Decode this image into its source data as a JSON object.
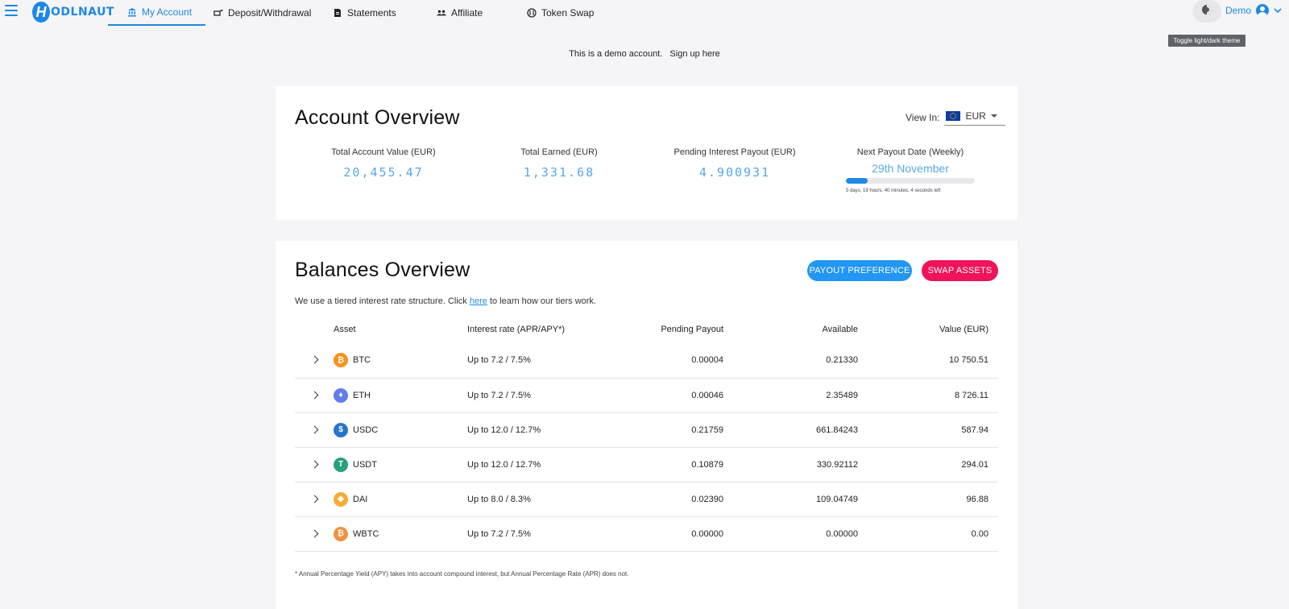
{
  "nav": {
    "logo_letter": "H",
    "logo_text": "ODLNAUT",
    "tabs": [
      {
        "label": "My Account",
        "icon": "bank-icon"
      },
      {
        "label": "Deposit/Withdrawal",
        "icon": "cash-transfer-icon"
      },
      {
        "label": "Statements",
        "icon": "document-icon"
      },
      {
        "label": "Affiliate",
        "icon": "people-icon"
      },
      {
        "label": "Token Swap",
        "icon": "swap-icon"
      }
    ],
    "theme_tooltip": "Toggle light/dark theme",
    "user_label": "Demo"
  },
  "demo": {
    "text": "This is a demo account.",
    "link": "Sign up here"
  },
  "account": {
    "title": "Account Overview",
    "view_in_label": "View In:",
    "currency": "EUR",
    "stats": [
      {
        "label": "Total Account Value (EUR)",
        "value": "20,455.47"
      },
      {
        "label": "Total Earned (EUR)",
        "value": "1,331.68"
      },
      {
        "label": "Pending Interest Payout (EUR)",
        "value": "4.900931"
      }
    ],
    "payout": {
      "label": "Next Payout Date (Weekly)",
      "date": "29th November",
      "progress_fraction": 0.17,
      "countdown": "5 days, 19 hours, 40 minutes, 4 seconds left"
    }
  },
  "balances": {
    "title": "Balances Overview",
    "payout_pref_button": "PAYOUT PREFERENCE",
    "swap_button": "SWAP ASSETS",
    "tier_note_before": "We use a tiered interest rate structure. Click ",
    "tier_note_link": "here",
    "tier_note_after": " to learn how our tiers work.",
    "columns": {
      "asset": "Asset",
      "rate": "Interest rate (APR/APY*)",
      "pending": "Pending Payout",
      "available": "Available",
      "value": "Value (EUR)"
    },
    "rows": [
      {
        "asset": "BTC",
        "rate": "Up to 7.2 / 7.5%",
        "pending": "0.00004",
        "available": "0.21330",
        "value": "10 750.51"
      },
      {
        "asset": "ETH",
        "rate": "Up to 7.2 / 7.5%",
        "pending": "0.00046",
        "available": "2.35489",
        "value": "8 726.11"
      },
      {
        "asset": "USDC",
        "rate": "Up to 12.0 / 12.7%",
        "pending": "0.21759",
        "available": "661.84243",
        "value": "587.94"
      },
      {
        "asset": "USDT",
        "rate": "Up to 12.0 / 12.7%",
        "pending": "0.10879",
        "available": "330.92112",
        "value": "294.01"
      },
      {
        "asset": "DAI",
        "rate": "Up to 8.0 / 8.3%",
        "pending": "0.02390",
        "available": "109.04749",
        "value": "96.88"
      },
      {
        "asset": "WBTC",
        "rate": "Up to 7.2 / 7.5%",
        "pending": "0.00000",
        "available": "0.00000",
        "value": "0.00"
      }
    ],
    "coin_icons": [
      {
        "name": "btc-icon",
        "glyph": "₿",
        "color": "#f7931a"
      },
      {
        "name": "eth-icon",
        "glyph": "♦",
        "color": "#627eea"
      },
      {
        "name": "usdc-icon",
        "glyph": "$",
        "color": "#2775ca"
      },
      {
        "name": "usdt-icon",
        "glyph": "T",
        "color": "#26a17b"
      },
      {
        "name": "dai-icon",
        "glyph": "◈",
        "color": "#f5ac37"
      },
      {
        "name": "wbtc-icon",
        "glyph": "₿",
        "color": "#f09242"
      }
    ],
    "footnote": "* Annual Percentage Yield (APY) takes into account compound interest, but Annual Percentage Rate (APR) does not."
  },
  "colors": {
    "accent": "#1e88e5",
    "value_text": "#5aa7e4",
    "swap_pink": "#f0135a",
    "background": "#f5f5f7"
  }
}
